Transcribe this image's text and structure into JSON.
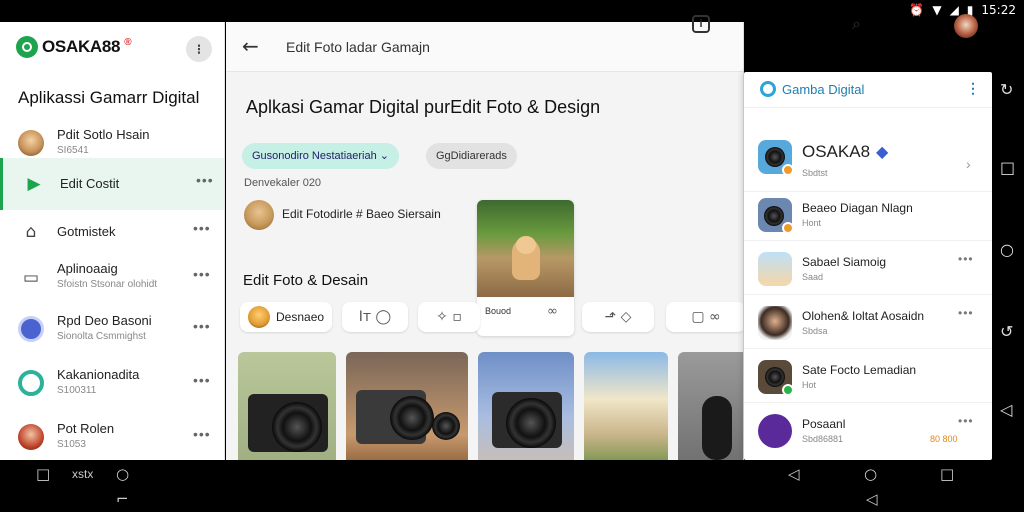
{
  "status": {
    "time": "15:22"
  },
  "left": {
    "brand": "OSAKA88",
    "title": "Aplikassi Gamarr Digital",
    "items": [
      {
        "title": "Pdit Sotlo Hsain",
        "sub": "SI6541"
      },
      {
        "title": "Edit Costit",
        "sub": ""
      },
      {
        "title": "Gotmistek",
        "sub": ""
      },
      {
        "title": "Aplinoaaig",
        "sub": "Sfoistn Stsonar olohidt"
      },
      {
        "title": "Rpd Deo Basoni",
        "sub": "Sionolta Csmmighst"
      },
      {
        "title": "Kakanionadita",
        "sub": "S100311"
      },
      {
        "title": "Pot Rolen",
        "sub": "S1053"
      }
    ],
    "more_label": "⁝"
  },
  "center": {
    "breadcrumb": "Edit Foto  ladar Gamajn",
    "heading": "Aplkasi Gamar Digital purEdit Foto & Design",
    "chips": [
      "Gusonodiro Nestatiaeriah",
      "GgDidiarerads"
    ],
    "section_label": "Denvekaler 020",
    "featured_text": "Edit Fotodirle  # Baeo Siersain",
    "featured_caption": "Bouod",
    "section2": "Edit Foto & Desain",
    "pill_first": "Desnaeo",
    "photo_captions": [
      "",
      "",
      "",
      "",
      ""
    ]
  },
  "panel": {
    "header": "Gamba Digital",
    "items": [
      {
        "title": "OSAKA8",
        "sub": "Sbdtst"
      },
      {
        "title": "Beaeo Diagan Nlagn",
        "sub": "Hont"
      },
      {
        "title": "Sabael Siamoig",
        "sub": "Saad"
      },
      {
        "title": "Olohen& Ioltat Aosaidn",
        "sub": "Sbdsa"
      },
      {
        "title": "Sate Focto Lemadian",
        "sub": "Hot"
      },
      {
        "title": "Posaanl",
        "sub": "Sbd86881",
        "extra": "80 800"
      }
    ]
  },
  "bottombar": {
    "left_label": "xstx"
  },
  "colors": {
    "brand": "#1ea44f",
    "accent": "#1c7fb0",
    "chip": "#c6efe6"
  }
}
